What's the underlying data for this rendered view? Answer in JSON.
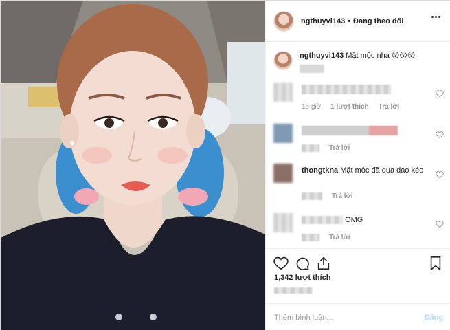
{
  "header": {
    "username": "ngthuyvi143",
    "separator": "•",
    "follow_status": "Đang theo dõi"
  },
  "caption": {
    "username": "ngthuyvi143",
    "text": "Mặt mộc nha 😵😵😵"
  },
  "comments": [
    {
      "username": "",
      "text": "",
      "time": "15 giờ",
      "likes": "1 lượt thích",
      "reply": "Trả lời"
    },
    {
      "username": "",
      "text": "",
      "time": "",
      "likes": "",
      "reply": "Trả lời"
    },
    {
      "username": "thongtkna",
      "text": "Mặt mộc đã qua dao kéo",
      "time": "",
      "likes": "",
      "reply": "Trả lời"
    },
    {
      "username": "",
      "text": "OMG",
      "time": "",
      "likes": "",
      "reply": "Trả lời"
    }
  ],
  "post": {
    "likes": "1,342 lượt thích"
  },
  "add_comment": {
    "placeholder": "Thêm bình luận...",
    "post_label": "Đăng"
  },
  "icons": {
    "like": "heart-icon",
    "comment": "comment-icon",
    "share": "share-icon",
    "save": "bookmark-icon",
    "more": "more-icon"
  },
  "colors": {
    "border": "#dbdbdb",
    "text": "#262626",
    "muted": "#999999",
    "post_button_disabled": "#b3dbff"
  }
}
